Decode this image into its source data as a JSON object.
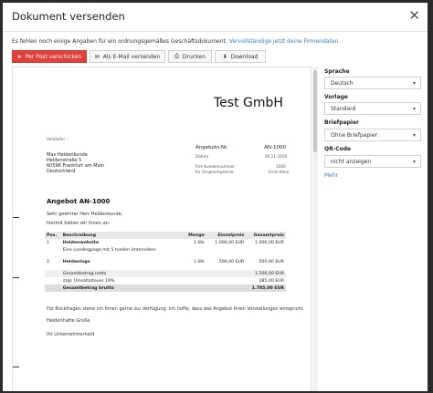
{
  "dialog": {
    "title": "Dokument versenden",
    "close_symbol": "✕",
    "hint_text": "Es fehlen noch einige Angaben für ein ordnungsgemäßes Geschäftsdokument.",
    "hint_link": "Vervollständige jetzt deine Firmendaten."
  },
  "toolbar": {
    "post_label": "Per Post verschicken",
    "email_label": "Als E-Mail versenden",
    "print_label": "Drucken",
    "download_label": "Download",
    "primary_color": "#e2403a"
  },
  "document": {
    "company_name": "Test GmbH",
    "sender_line": "Verkäufer –",
    "recipient": {
      "name": "Max Heldenkunde",
      "street": "Heldenstraße 5",
      "city": "60596 Frankfurt am Main",
      "country": "Deutschland"
    },
    "meta": {
      "doc_type_label": "Angebots-Nr.",
      "doc_number": "AN-1000",
      "date_label": "Datum",
      "date_value": "20.11.2018",
      "customer_no_label": "Ihre Kundennummer",
      "customer_no_value": "1000",
      "contact_label": "Ihr Ansprechpartner",
      "contact_value": "Ernie Klein"
    },
    "heading": "Angebot AN-1000",
    "greeting": "Sehr geehrter Herr Heldenkunde,",
    "intro": "hiermit bieten wir Ihnen an:",
    "table": {
      "headers": [
        "Pos.",
        "Beschreibung",
        "Menge",
        "Einzelpreis",
        "Gesamtpreis"
      ],
      "rows": [
        {
          "pos": "1.",
          "title": "Heldenwebsite",
          "desc": "Eine Landingpage mit 5 toollen Unterseiten",
          "qty": "1 Stk",
          "unit": "1.000,00 EUR",
          "total": "1.000,00 EUR"
        },
        {
          "pos": "2.",
          "title": "Heldenlogo",
          "desc": "",
          "qty": "1 Stk",
          "unit": "500,00 EUR",
          "total": "500,00 EUR"
        }
      ],
      "net_label": "Gesamtbetrag netto",
      "net_value": "1.500,00 EUR",
      "tax_label": "zzgl. Umsatzsteuer 19%",
      "tax_value": "285,00 EUR",
      "gross_label": "Gesamtbetrag brutto",
      "gross_value": "1.785,00 EUR"
    },
    "closing_text": "Für Rückfragen stehe ich Ihnen gerne zur Verfügung. Ich hoffe, dass das Angebot Ihren Vorstellungen entspricht.",
    "regards": "Heldenhafte Grüße",
    "signature": "Ihr Unternehmerheld"
  },
  "sidebar": {
    "language_label": "Sprache",
    "language_value": "Deutsch",
    "template_label": "Vorlage",
    "template_value": "Standard",
    "letterhead_label": "Briefpapier",
    "letterhead_value": "Ohne Briefpapier",
    "qr_label": "QR-Code",
    "qr_value": "nicht anzeigen",
    "more_link": "Mehr"
  }
}
